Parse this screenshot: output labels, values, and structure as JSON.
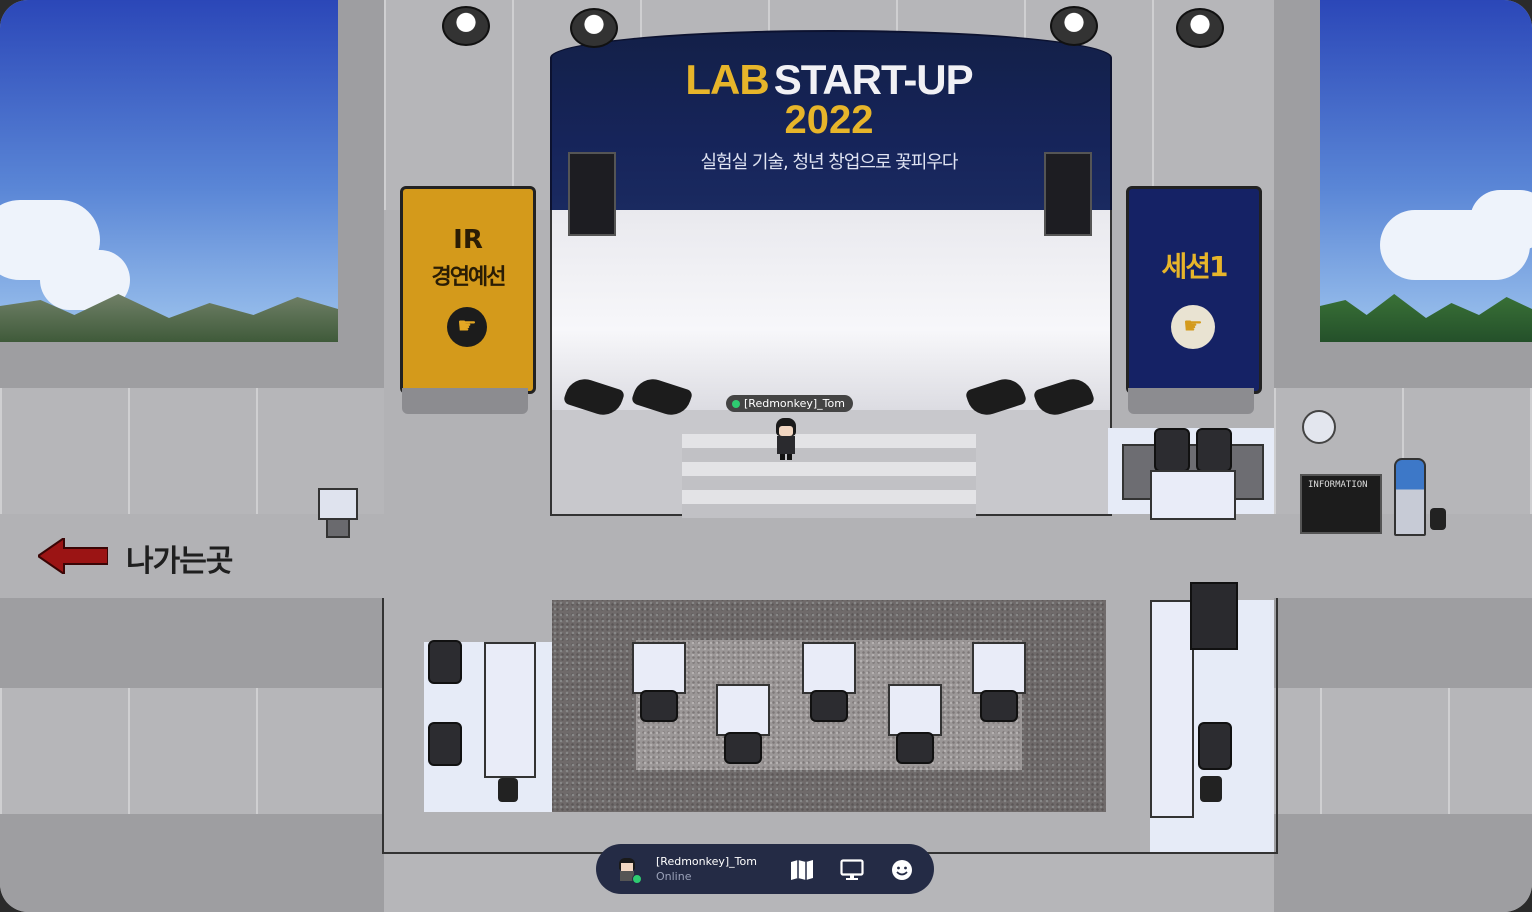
{
  "stage": {
    "title_lab": "LAB",
    "title_startup": "START-UP",
    "title_year": "2022",
    "subtitle": "실험실 기술, 청년 창업으로 꽃피우다"
  },
  "banners": {
    "ir_line1": "IR",
    "ir_line2": "경연예선",
    "session": "세션1"
  },
  "exit": {
    "label": "나가는곳"
  },
  "information_board": {
    "label": "INFORMATION"
  },
  "player": {
    "nameplate": "[Redmonkey]_Tom"
  },
  "hud": {
    "user_name": "[Redmonkey]_Tom",
    "status": "Online",
    "icons": [
      "map-icon",
      "screen-share-icon",
      "emoji-icon"
    ]
  },
  "colors": {
    "online": "#2ecc71",
    "hud_bg": "#242b45",
    "ir_banner": "#d49a1b",
    "session_banner": "#152265",
    "exit_arrow": "#9b1414"
  }
}
